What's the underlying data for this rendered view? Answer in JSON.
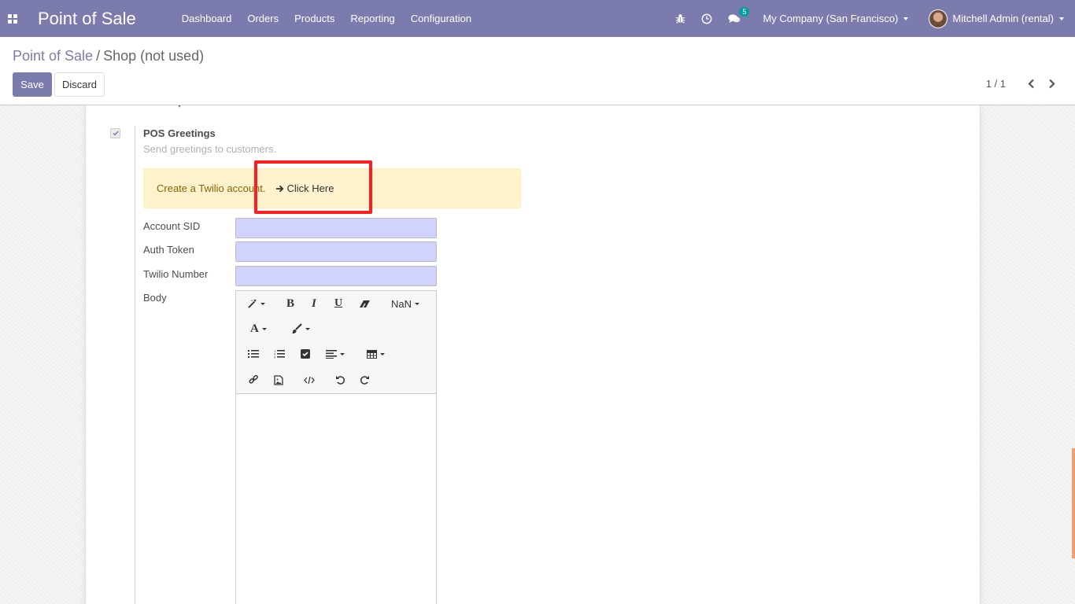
{
  "navbar": {
    "app_title": "Point of Sale",
    "menu": [
      "Dashboard",
      "Orders",
      "Products",
      "Reporting",
      "Configuration"
    ],
    "messages_count": "5",
    "company": "My Company (San Francisco)",
    "user": "Mitchell Admin (rental)"
  },
  "breadcrumb": {
    "parent": "Point of Sale",
    "separator": "/",
    "current": "Shop (not used)"
  },
  "buttons": {
    "save": "Save",
    "discard": "Discard"
  },
  "pager": {
    "value": "1 / 1"
  },
  "setting": {
    "enabled": true,
    "title": "POS Greetings",
    "description": "Send greetings to customers.",
    "alert_text": "Create a Twilio account.",
    "alert_link": "Click Here"
  },
  "fields": {
    "account_sid": {
      "label": "Account SID",
      "value": ""
    },
    "auth_token": {
      "label": "Auth Token",
      "value": ""
    },
    "twilio_number": {
      "label": "Twilio Number",
      "value": ""
    },
    "body": {
      "label": "Body"
    }
  },
  "editor": {
    "font_size": "NaN"
  },
  "colors": {
    "brand": "#7c7bad",
    "input_required": "#d2d2ff",
    "alert_bg": "#fff3cd",
    "highlight": "#ff1d1d"
  }
}
